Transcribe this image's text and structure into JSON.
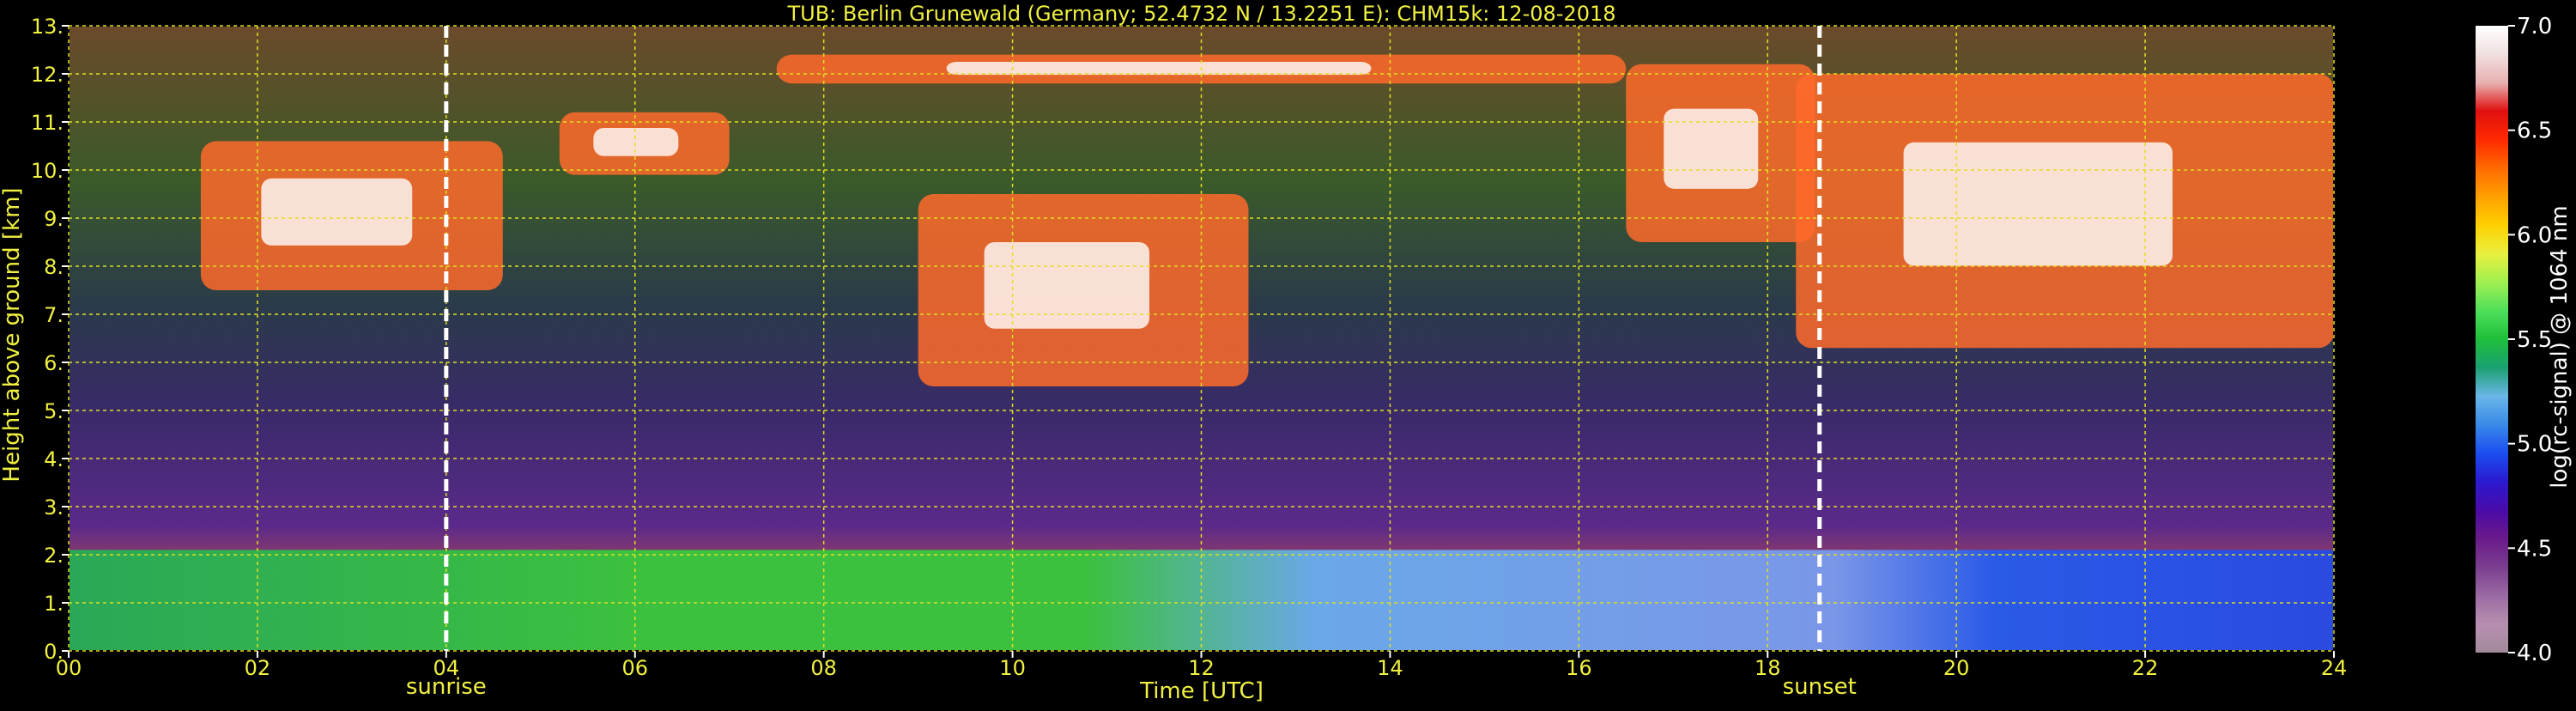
{
  "chart_data": {
    "type": "heatmap",
    "title": "TUB: Berlin Grunewald (Germany; 52.4732 N / 13.2251 E):    CHM15k: 12-08-2018",
    "xlabel": "Time [UTC]",
    "ylabel": "Height above ground [km]",
    "xlim": [
      0,
      24
    ],
    "ylim": [
      0,
      13
    ],
    "x_ticks": [
      "00",
      "02",
      "04",
      "06",
      "08",
      "10",
      "12",
      "14",
      "16",
      "18",
      "20",
      "22",
      "24"
    ],
    "y_ticks": [
      "0.",
      "1.",
      "2.",
      "3.",
      "4.",
      "5.",
      "6.",
      "7.",
      "8.",
      "9.",
      "10.",
      "11.",
      "12.",
      "13."
    ],
    "grid": true,
    "annotations": [
      {
        "label": "sunrise",
        "x": 4.0
      },
      {
        "label": "sunset",
        "x": 18.55
      }
    ],
    "colorbar": {
      "label": "log(rc-signal) @ 1064 nm",
      "range": [
        4.0,
        7.0
      ],
      "ticks": [
        "4.0",
        "4.5",
        "5.0",
        "5.5",
        "6.0",
        "6.5",
        "7.0"
      ],
      "colors": [
        "#a38a9c",
        "#b78fb0",
        "#9a6aa3",
        "#7a3e8f",
        "#6a1a8a",
        "#4a0aa8",
        "#2a1ad0",
        "#1a4ef0",
        "#3a8ae8",
        "#6ab6e8",
        "#1aa070",
        "#1fbf3a",
        "#4ee05a",
        "#a0f050",
        "#e8f040",
        "#ffd000",
        "#ffa000",
        "#ff6a00",
        "#ff2a00",
        "#e01010",
        "#e8b0b0",
        "#f0e0e0",
        "#ffffff"
      ]
    },
    "layers": [
      {
        "name": "boundary-layer",
        "x": [
          0,
          24
        ],
        "y": [
          0,
          2.1
        ]
      },
      {
        "name": "cloud",
        "x": [
          1.4,
          4.6
        ],
        "y": [
          7.5,
          10.6
        ]
      },
      {
        "name": "cloud",
        "x": [
          5.2,
          7.0
        ],
        "y": [
          9.9,
          11.2
        ]
      },
      {
        "name": "cloud",
        "x": [
          9.0,
          12.5
        ],
        "y": [
          5.5,
          9.5
        ]
      },
      {
        "name": "cloud",
        "x": [
          7.5,
          16.5
        ],
        "y": [
          11.8,
          12.4
        ]
      },
      {
        "name": "cloud",
        "x": [
          16.5,
          18.5
        ],
        "y": [
          8.5,
          12.2
        ]
      },
      {
        "name": "cloud",
        "x": [
          18.3,
          24.0
        ],
        "y": [
          6.3,
          12.0
        ]
      }
    ]
  }
}
